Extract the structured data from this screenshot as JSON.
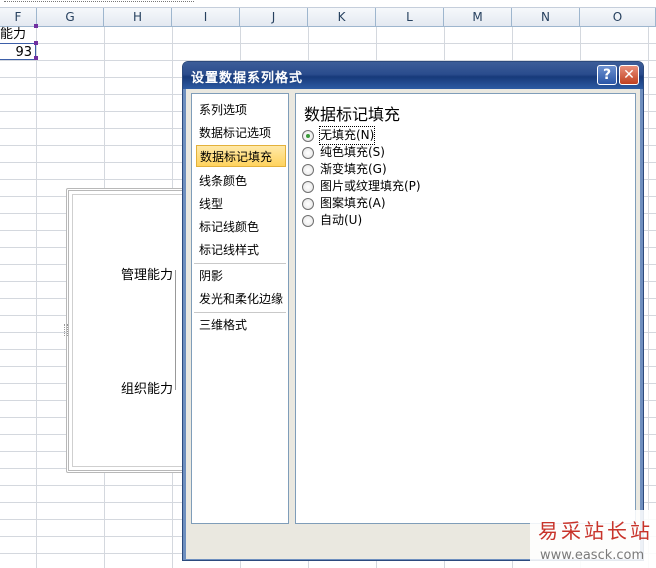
{
  "sheet": {
    "columns": [
      "F",
      "G",
      "H",
      "I",
      "J",
      "K",
      "L",
      "M",
      "N",
      "O"
    ],
    "cells": {
      "a1": "能力",
      "b1": "93"
    }
  },
  "chart": {
    "labels": [
      "管理能力",
      "组织能力"
    ]
  },
  "dialog": {
    "title": "设置数据系列格式",
    "help_label": "?",
    "close_label": "✕",
    "nav": [
      {
        "label": "系列选项"
      },
      {
        "label": "数据标记选项"
      },
      {
        "label": "数据标记填充",
        "active": true
      },
      {
        "label": "线条颜色"
      },
      {
        "label": "线型"
      },
      {
        "label": "标记线颜色"
      },
      {
        "label": "标记线样式"
      },
      {
        "label": "阴影"
      },
      {
        "label": "发光和柔化边缘"
      },
      {
        "label": "三维格式"
      }
    ],
    "panel": {
      "title": "数据标记填充",
      "options": [
        {
          "label": "无填充(N)",
          "checked": true
        },
        {
          "label": "纯色填充(S)",
          "checked": false
        },
        {
          "label": "渐变填充(G)",
          "checked": false
        },
        {
          "label": "图片或纹理填充(P)",
          "checked": false
        },
        {
          "label": "图案填充(A)",
          "checked": false
        },
        {
          "label": "自动(U)",
          "checked": false
        }
      ]
    }
  },
  "watermark": {
    "title": "易采站长站",
    "url": "www.easck.com"
  },
  "colors": {
    "title_bar": "#2a4c8d",
    "active_nav": "#ffd35e",
    "radio_dot": "#3a9a3a",
    "watermark_red": "#c8332a"
  },
  "icons": [
    "help-icon",
    "close-icon",
    "radio-icon"
  ]
}
